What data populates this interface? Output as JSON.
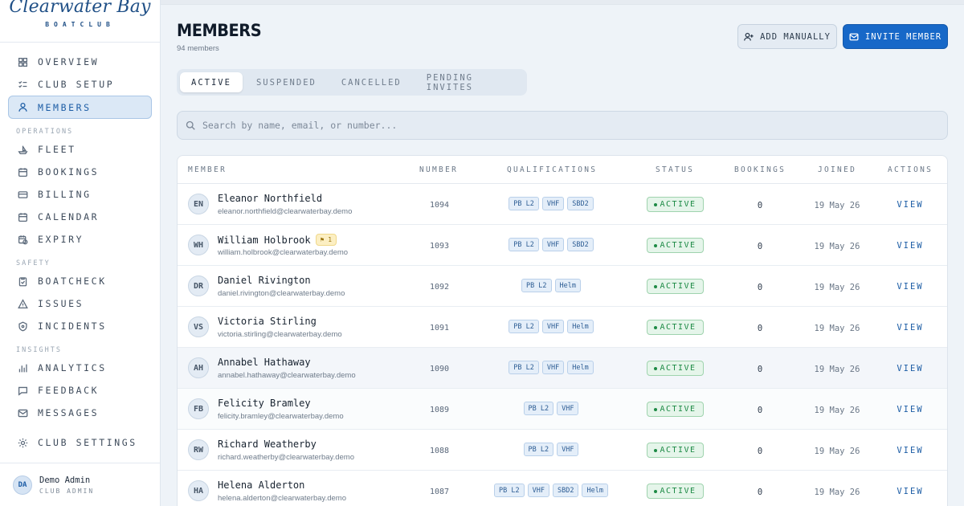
{
  "brand": {
    "name": "Clearwater Bay",
    "subtitle": "BOATCLUB"
  },
  "sidebar": {
    "items": [
      {
        "label": "OVERVIEW",
        "icon": "grid-icon"
      },
      {
        "label": "CLUB SETUP",
        "icon": "checklist-icon"
      },
      {
        "label": "MEMBERS",
        "icon": "user-icon",
        "active": true
      }
    ],
    "sections": [
      {
        "title": "OPERATIONS",
        "items": [
          {
            "label": "FLEET",
            "icon": "boat-icon"
          },
          {
            "label": "BOOKINGS",
            "icon": "calendar-icon"
          },
          {
            "label": "BILLING",
            "icon": "card-icon"
          },
          {
            "label": "CALENDAR",
            "icon": "calendar-icon"
          },
          {
            "label": "EXPIRY",
            "icon": "calendar-clock-icon"
          }
        ]
      },
      {
        "title": "SAFETY",
        "items": [
          {
            "label": "BOATCHECK",
            "icon": "clipboard-check-icon"
          },
          {
            "label": "ISSUES",
            "icon": "warning-icon"
          },
          {
            "label": "INCIDENTS",
            "icon": "shield-icon"
          }
        ]
      },
      {
        "title": "INSIGHTS",
        "items": [
          {
            "label": "ANALYTICS",
            "icon": "bar-chart-icon"
          },
          {
            "label": "FEEDBACK",
            "icon": "chat-icon"
          },
          {
            "label": "MESSAGES",
            "icon": "mail-icon"
          }
        ]
      }
    ],
    "bottom_item": {
      "label": "CLUB SETTINGS",
      "icon": "gear-icon"
    },
    "user": {
      "initials": "DA",
      "name": "Demo Admin",
      "role": "CLUB ADMIN"
    }
  },
  "header": {
    "title": "MEMBERS",
    "subtitle": "94 members",
    "add_manually": "ADD MANUALLY",
    "invite_member": "INVITE MEMBER"
  },
  "tabs": [
    {
      "label": "ACTIVE",
      "active": true
    },
    {
      "label": "SUSPENDED"
    },
    {
      "label": "CANCELLED"
    },
    {
      "label": "PENDING INVITES"
    }
  ],
  "search": {
    "placeholder": "Search by name, email, or number..."
  },
  "table": {
    "columns": [
      "MEMBER",
      "NUMBER",
      "QUALIFICATIONS",
      "STATUS",
      "BOOKINGS",
      "JOINED",
      "ACTIONS"
    ],
    "rows": [
      {
        "initials": "EN",
        "name": "Eleanor Northfield",
        "email": "eleanor.northfield@clearwaterbay.demo",
        "number": "1094",
        "quals": [
          "PB L2",
          "VHF",
          "SBD2"
        ],
        "status": "ACTIVE",
        "bookings": "0",
        "joined": "19 May 26",
        "action": "VIEW"
      },
      {
        "initials": "WH",
        "name": "William Holbrook",
        "flag": "1",
        "email": "william.holbrook@clearwaterbay.demo",
        "number": "1093",
        "quals": [
          "PB L2",
          "VHF",
          "SBD2"
        ],
        "status": "ACTIVE",
        "bookings": "0",
        "joined": "19 May 26",
        "action": "VIEW"
      },
      {
        "initials": "DR",
        "name": "Daniel Rivington",
        "email": "daniel.rivington@clearwaterbay.demo",
        "number": "1092",
        "quals": [
          "PB L2",
          "Helm"
        ],
        "status": "ACTIVE",
        "bookings": "0",
        "joined": "19 May 26",
        "action": "VIEW"
      },
      {
        "initials": "VS",
        "name": "Victoria Stirling",
        "email": "victoria.stirling@clearwaterbay.demo",
        "number": "1091",
        "quals": [
          "PB L2",
          "VHF",
          "Helm"
        ],
        "status": "ACTIVE",
        "bookings": "0",
        "joined": "19 May 26",
        "action": "VIEW"
      },
      {
        "initials": "AH",
        "name": "Annabel Hathaway",
        "email": "annabel.hathaway@clearwaterbay.demo",
        "number": "1090",
        "quals": [
          "PB L2",
          "VHF",
          "Helm"
        ],
        "status": "ACTIVE",
        "bookings": "0",
        "joined": "19 May 26",
        "action": "VIEW"
      },
      {
        "initials": "FB",
        "name": "Felicity Bramley",
        "email": "felicity.bramley@clearwaterbay.demo",
        "number": "1089",
        "quals": [
          "PB L2",
          "VHF"
        ],
        "status": "ACTIVE",
        "bookings": "0",
        "joined": "19 May 26",
        "action": "VIEW"
      },
      {
        "initials": "RW",
        "name": "Richard Weatherby",
        "email": "richard.weatherby@clearwaterbay.demo",
        "number": "1088",
        "quals": [
          "PB L2",
          "VHF"
        ],
        "status": "ACTIVE",
        "bookings": "0",
        "joined": "19 May 26",
        "action": "VIEW"
      },
      {
        "initials": "HA",
        "name": "Helena Alderton",
        "email": "helena.alderton@clearwaterbay.demo",
        "number": "1087",
        "quals": [
          "PB L2",
          "VHF",
          "SBD2",
          "Helm"
        ],
        "status": "ACTIVE",
        "bookings": "0",
        "joined": "19 May 26",
        "action": "VIEW"
      }
    ]
  }
}
